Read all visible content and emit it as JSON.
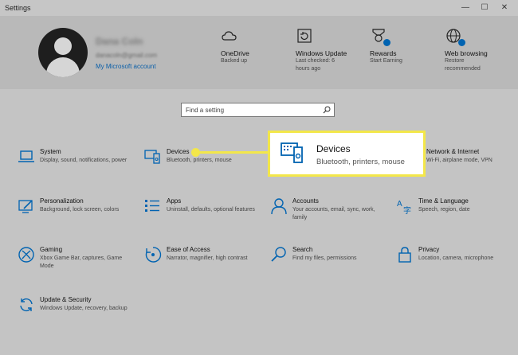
{
  "window": {
    "title": "Settings",
    "minimize": "—",
    "maximize": "☐",
    "close": "✕"
  },
  "account": {
    "name": "Dana Coln",
    "email": "danacoln@gmail.com",
    "link": "My Microsoft account"
  },
  "header_items": [
    {
      "icon": "cloud-icon",
      "label": "OneDrive",
      "sub": "Backed up"
    },
    {
      "icon": "windows-update-icon",
      "label": "Windows Update",
      "sub": "Last checked: 6 hours ago"
    },
    {
      "icon": "rewards-icon",
      "label": "Rewards",
      "sub": "Start Earning"
    },
    {
      "icon": "globe-icon",
      "label": "Web browsing",
      "sub": "Restore recommended"
    }
  ],
  "search": {
    "placeholder": "Find a setting"
  },
  "tiles": [
    {
      "name": "System",
      "desc": "Display, sound, notifications, power",
      "icon": "laptop-icon"
    },
    {
      "name": "Devices",
      "desc": "Bluetooth, printers, mouse",
      "icon": "devices-icon"
    },
    {
      "name": "Network & Internet",
      "desc": "Wi-Fi, airplane mode, VPN",
      "icon": "globe-icon"
    },
    {
      "name": "Personalization",
      "desc": "Background, lock screen, colors",
      "icon": "personalization-icon"
    },
    {
      "name": "Apps",
      "desc": "Uninstall, defaults, optional features",
      "icon": "apps-icon"
    },
    {
      "name": "Accounts",
      "desc": "Your accounts, email, sync, work, family",
      "icon": "person-icon"
    },
    {
      "name": "Time & Language",
      "desc": "Speech, region, date",
      "icon": "time-language-icon"
    },
    {
      "name": "Gaming",
      "desc": "Xbox Game Bar, captures, Game Mode",
      "icon": "xbox-icon"
    },
    {
      "name": "Ease of Access",
      "desc": "Narrator, magnifier, high contrast",
      "icon": "ease-of-access-icon"
    },
    {
      "name": "Search",
      "desc": "Find my files, permissions",
      "icon": "search-icon"
    },
    {
      "name": "Privacy",
      "desc": "Location, camera, microphone",
      "icon": "lock-icon"
    },
    {
      "name": "Update & Security",
      "desc": "Windows Update, recovery, backup",
      "icon": "update-icon"
    }
  ],
  "callout": {
    "name": "Devices",
    "desc": "Bluetooth, printers, mouse"
  },
  "colors": {
    "accent": "#0063b1",
    "highlight": "#f3e74a",
    "link": "#0b5fa8"
  }
}
